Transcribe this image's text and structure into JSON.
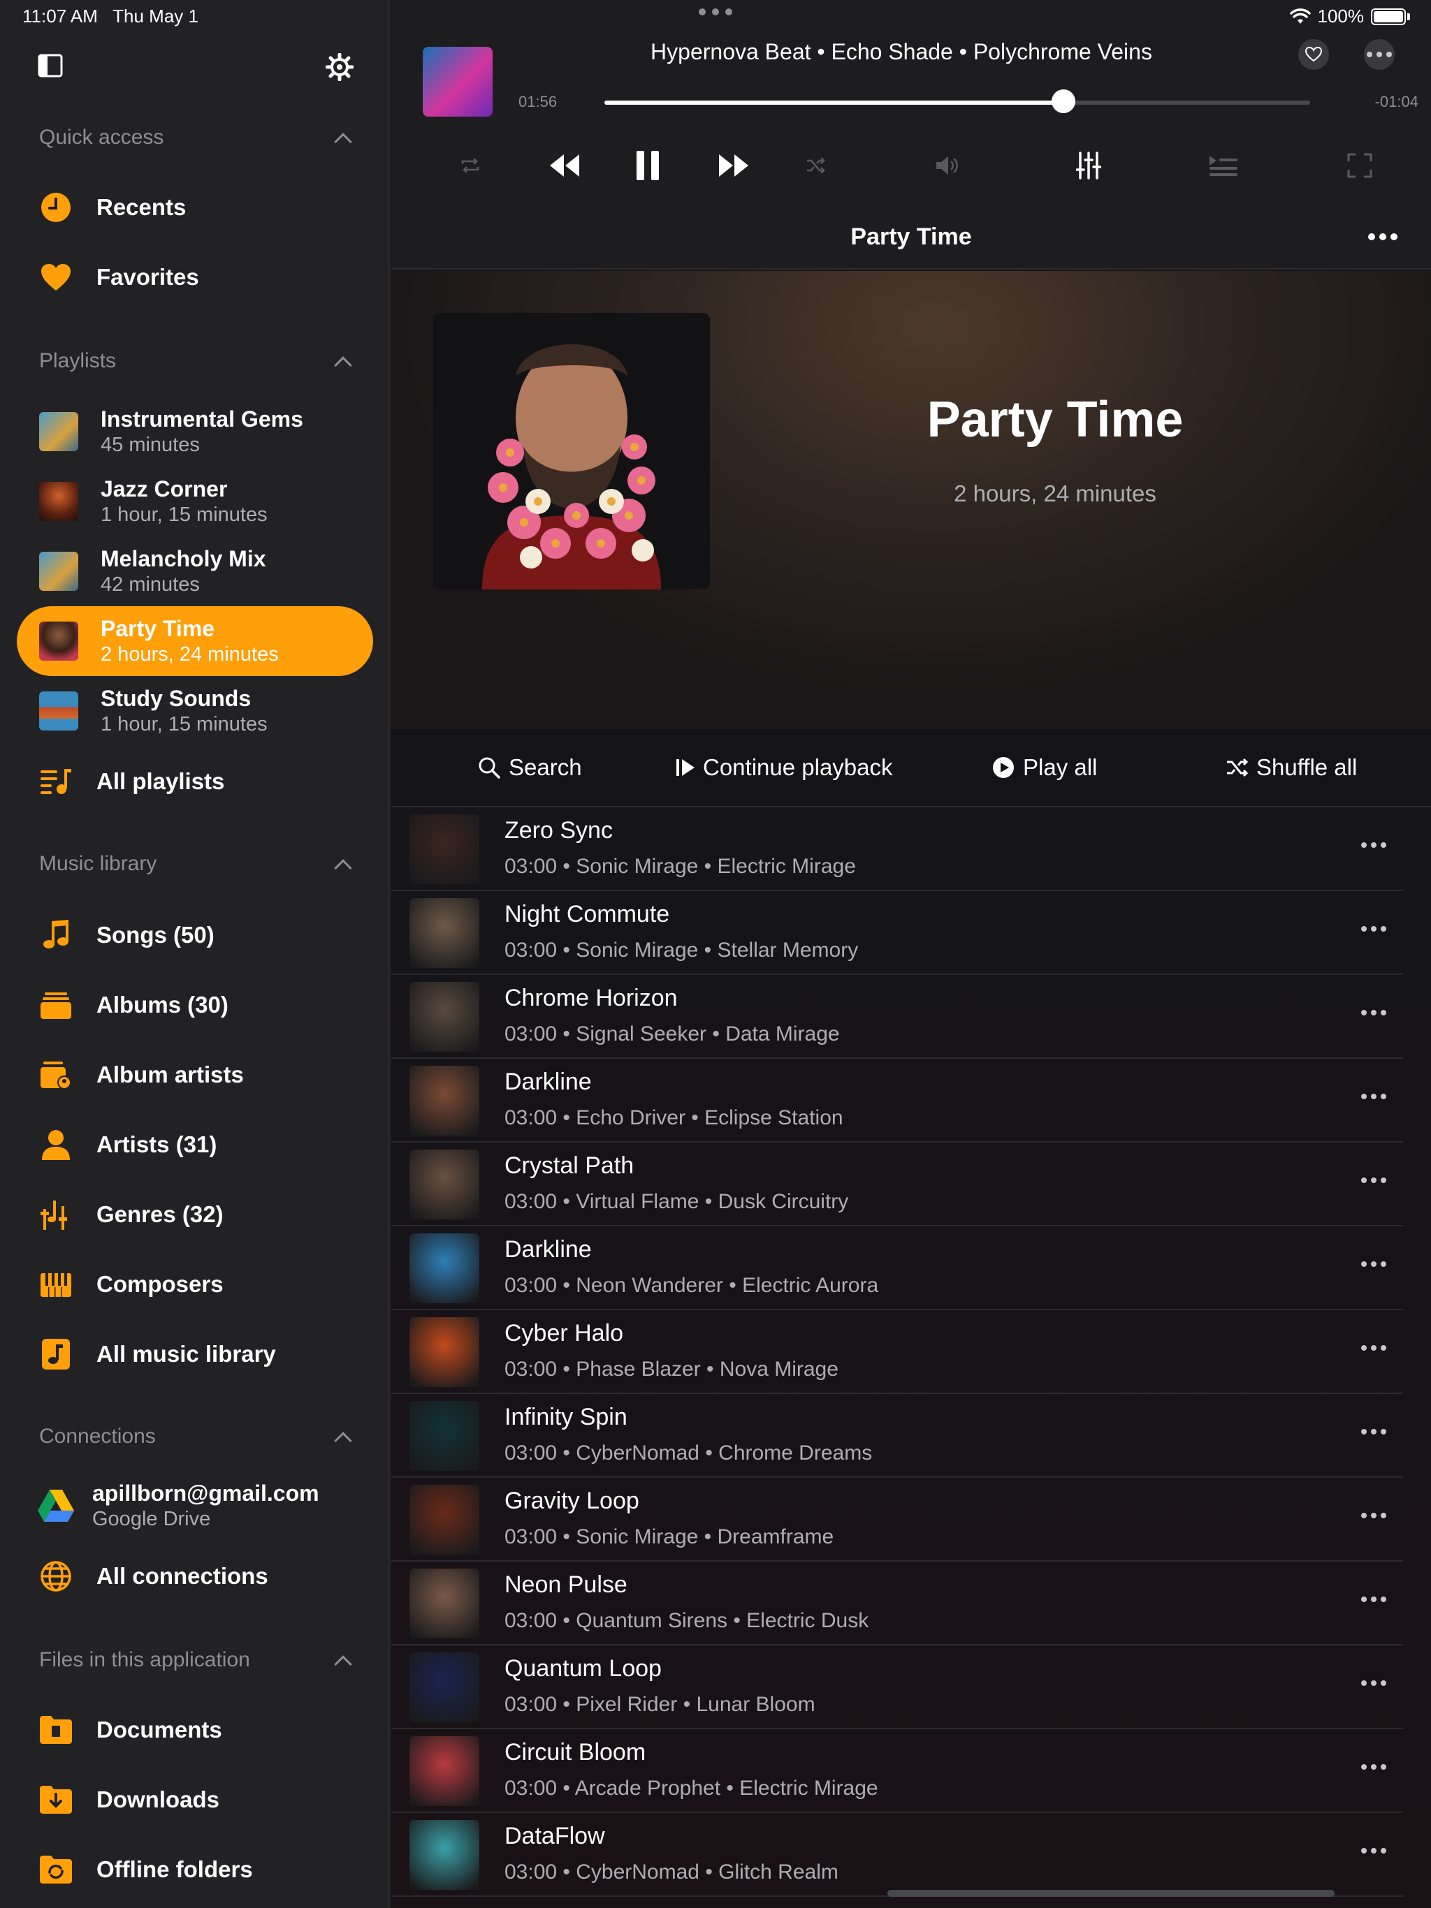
{
  "status_bar": {
    "time": "11:07 AM",
    "date": "Thu May 1",
    "battery": "100%"
  },
  "colors": {
    "accent": "#ff9f0a",
    "sidebar_bg": "#222224",
    "main_bg": "#161618"
  },
  "sidebar": {
    "sections": {
      "quick_access": "Quick access",
      "playlists": "Playlists",
      "music_library": "Music library",
      "connections": "Connections",
      "files": "Files in this application"
    },
    "quick_access": [
      {
        "label": "Recents",
        "icon": "clock-icon"
      },
      {
        "label": "Favorites",
        "icon": "heart-icon"
      }
    ],
    "playlists": [
      {
        "name": "Instrumental Gems",
        "duration": "45 minutes"
      },
      {
        "name": "Jazz Corner",
        "duration": "1 hour, 15 minutes"
      },
      {
        "name": "Melancholy Mix",
        "duration": "42 minutes"
      },
      {
        "name": "Party Time",
        "duration": "2 hours, 24 minutes",
        "active": true
      },
      {
        "name": "Study Sounds",
        "duration": "1 hour, 15 minutes"
      }
    ],
    "all_playlists": "All playlists",
    "music_library": [
      {
        "label": "Songs (50)",
        "icon": "music-note-icon"
      },
      {
        "label": "Albums (30)",
        "icon": "albums-icon"
      },
      {
        "label": "Album artists",
        "icon": "album-artist-icon"
      },
      {
        "label": "Artists (31)",
        "icon": "person-icon"
      },
      {
        "label": "Genres (32)",
        "icon": "genres-icon"
      },
      {
        "label": "Composers",
        "icon": "piano-icon"
      },
      {
        "label": "All music library",
        "icon": "music-library-icon"
      }
    ],
    "connections": {
      "account": "apillborn@gmail.com",
      "service": "Google Drive",
      "all": "All connections"
    },
    "files": [
      {
        "label": "Documents",
        "icon": "documents-folder-icon"
      },
      {
        "label": "Downloads",
        "icon": "downloads-folder-icon"
      },
      {
        "label": "Offline folders",
        "icon": "offline-folder-icon"
      }
    ]
  },
  "now_playing": {
    "title": "Hypernova Beat • Echo Shade • Polychrome Veins",
    "elapsed": "01:56",
    "remaining": "-01:04",
    "progress": 0.65
  },
  "playlist": {
    "header": "Party Time",
    "title": "Party Time",
    "duration": "2 hours, 24 minutes"
  },
  "actions": {
    "search": "Search",
    "continue": "Continue playback",
    "play_all": "Play all",
    "shuffle_all": "Shuffle all"
  },
  "songs": [
    {
      "title": "Zero Sync",
      "meta": "03:00 • Sonic Mirage • Electric Mirage",
      "color": "#3a2420"
    },
    {
      "title": "Night Commute",
      "meta": "03:00 • Sonic Mirage • Stellar Memory",
      "color": "#6e5a48"
    },
    {
      "title": "Chrome Horizon",
      "meta": "03:00 • Signal Seeker • Data Mirage",
      "color": "#5a4a3e"
    },
    {
      "title": "Darkline",
      "meta": "03:00 • Echo Driver • Eclipse Station",
      "color": "#7a4a34"
    },
    {
      "title": "Crystal Path",
      "meta": "03:00 • Virtual Flame • Dusk Circuitry",
      "color": "#6a5040"
    },
    {
      "title": "Darkline",
      "meta": "03:00 • Neon Wanderer • Electric Aurora",
      "color": "#2f7fb8"
    },
    {
      "title": "Cyber Halo",
      "meta": "03:00 • Phase Blazer • Nova Mirage",
      "color": "#c24a1c"
    },
    {
      "title": "Infinity Spin",
      "meta": "03:00 • CyberNomad • Chrome Dreams",
      "color": "#123238"
    },
    {
      "title": "Gravity Loop",
      "meta": "03:00 • Sonic Mirage • Dreamframe",
      "color": "#6a2a1a"
    },
    {
      "title": "Neon Pulse",
      "meta": "03:00 • Quantum Sirens • Electric Dusk",
      "color": "#7a5a48"
    },
    {
      "title": "Quantum Loop",
      "meta": "03:00 • Pixel Rider • Lunar Bloom",
      "color": "#1a2450"
    },
    {
      "title": "Circuit Bloom",
      "meta": "03:00 • Arcade Prophet • Electric Mirage",
      "color": "#b83a40"
    },
    {
      "title": "DataFlow",
      "meta": "03:00 • CyberNomad • Glitch Realm",
      "color": "#3aa0a8"
    }
  ]
}
